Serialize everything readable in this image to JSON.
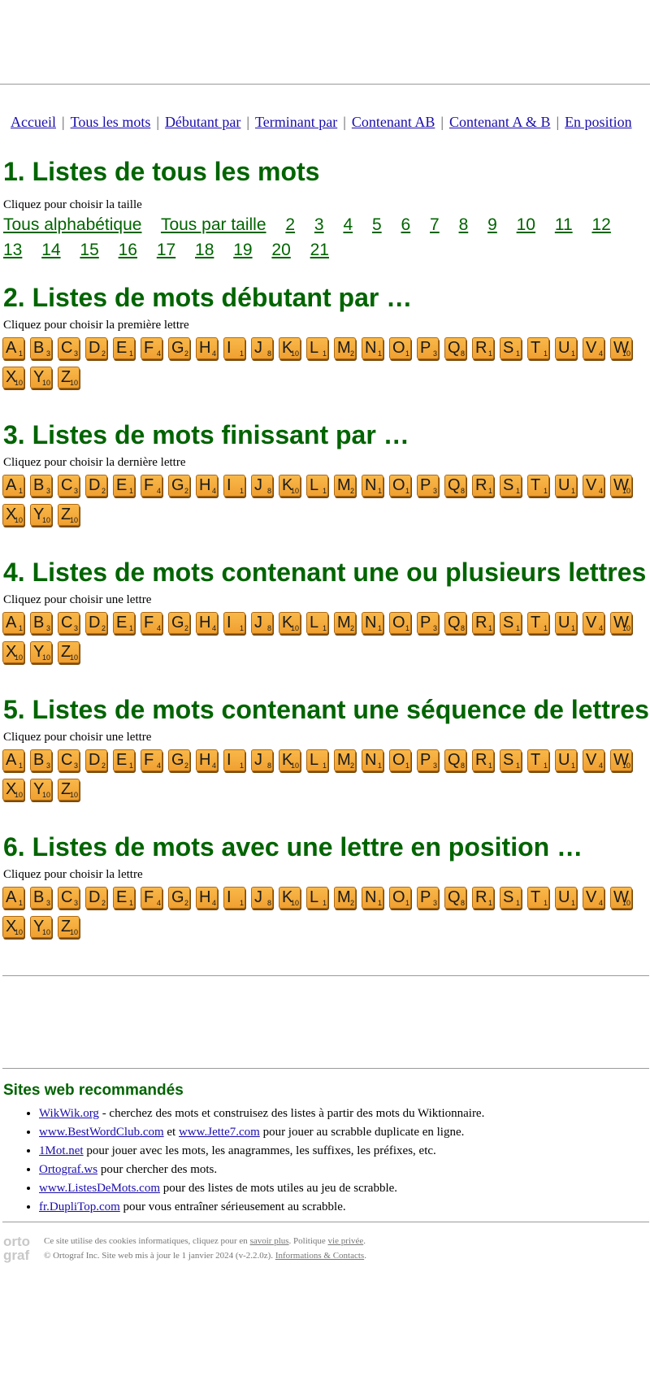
{
  "nav": {
    "items": [
      "Accueil",
      "Tous les mots",
      "Débutant par",
      "Terminant par",
      "Contenant AB",
      "Contenant A & B",
      "En position"
    ],
    "separator": "|"
  },
  "sections": [
    {
      "title": "1. Listes de tous les mots",
      "prompt": "Cliquez pour choisir la taille"
    },
    {
      "title": "2. Listes de mots débutant par …",
      "prompt": "Cliquez pour choisir la première lettre"
    },
    {
      "title": "3. Listes de mots finissant par …",
      "prompt": "Cliquez pour choisir la dernière lettre"
    },
    {
      "title": "4. Listes de mots contenant une ou plusieurs lettres",
      "prompt": "Cliquez pour choisir une lettre"
    },
    {
      "title": "5. Listes de mots contenant une séquence de lettres",
      "prompt": "Cliquez pour choisir une lettre"
    },
    {
      "title": "6. Listes de mots avec une lettre en position …",
      "prompt": "Cliquez pour choisir la lettre"
    }
  ],
  "sizes": [
    "Tous alphabétique",
    "Tous par taille",
    "2",
    "3",
    "4",
    "5",
    "6",
    "7",
    "8",
    "9",
    "10",
    "11",
    "12",
    "13",
    "14",
    "15",
    "16",
    "17",
    "18",
    "19",
    "20",
    "21"
  ],
  "tiles": [
    {
      "letter": "A",
      "points": "1"
    },
    {
      "letter": "B",
      "points": "3"
    },
    {
      "letter": "C",
      "points": "3"
    },
    {
      "letter": "D",
      "points": "2"
    },
    {
      "letter": "E",
      "points": "1"
    },
    {
      "letter": "F",
      "points": "4"
    },
    {
      "letter": "G",
      "points": "2"
    },
    {
      "letter": "H",
      "points": "4"
    },
    {
      "letter": "I",
      "points": "1"
    },
    {
      "letter": "J",
      "points": "8"
    },
    {
      "letter": "K",
      "points": "10"
    },
    {
      "letter": "L",
      "points": "1"
    },
    {
      "letter": "M",
      "points": "2"
    },
    {
      "letter": "N",
      "points": "1"
    },
    {
      "letter": "O",
      "points": "1"
    },
    {
      "letter": "P",
      "points": "3"
    },
    {
      "letter": "Q",
      "points": "8"
    },
    {
      "letter": "R",
      "points": "1"
    },
    {
      "letter": "S",
      "points": "1"
    },
    {
      "letter": "T",
      "points": "1"
    },
    {
      "letter": "U",
      "points": "1"
    },
    {
      "letter": "V",
      "points": "4"
    },
    {
      "letter": "W",
      "points": "10"
    },
    {
      "letter": "X",
      "points": "10"
    },
    {
      "letter": "Y",
      "points": "10"
    },
    {
      "letter": "Z",
      "points": "10"
    }
  ],
  "recs": {
    "title": "Sites web recommandés",
    "items": [
      {
        "links": [
          "WikWik.org"
        ],
        "text": " - cherchez des mots et construisez des listes à partir des mots du Wiktionnaire."
      },
      {
        "links": [
          "www.BestWordClub.com",
          "www.Jette7.com"
        ],
        "joiner": " et ",
        "text": " pour jouer au scrabble duplicate en ligne."
      },
      {
        "links": [
          "1Mot.net"
        ],
        "text": " pour jouer avec les mots, les anagrammes, les suffixes, les préfixes, etc."
      },
      {
        "links": [
          "Ortograf.ws"
        ],
        "text": " pour chercher des mots."
      },
      {
        "links": [
          "www.ListesDeMots.com"
        ],
        "text": " pour des listes de mots utiles au jeu de scrabble."
      },
      {
        "links": [
          "fr.DupliTop.com"
        ],
        "text": " pour vous entraîner sérieusement au scrabble."
      }
    ]
  },
  "footer": {
    "logo_line1": "orto",
    "logo_line2": "graf",
    "cookie_text": "Ce site utilise des cookies informatiques, cliquez pour en ",
    "cookie_link": "savoir plus",
    "privacy_prefix": ". Politique ",
    "privacy_link": "vie privée",
    "privacy_suffix": ".",
    "copyright_text": "© Ortograf Inc. Site web mis à jour le 1 janvier 2024 (v-2.2.0z). ",
    "contacts_link": "Informations & Contacts",
    "contacts_suffix": "."
  },
  "colors": {
    "heading": "#006400",
    "link": "#1a0dab",
    "tile": "#f0a030"
  }
}
